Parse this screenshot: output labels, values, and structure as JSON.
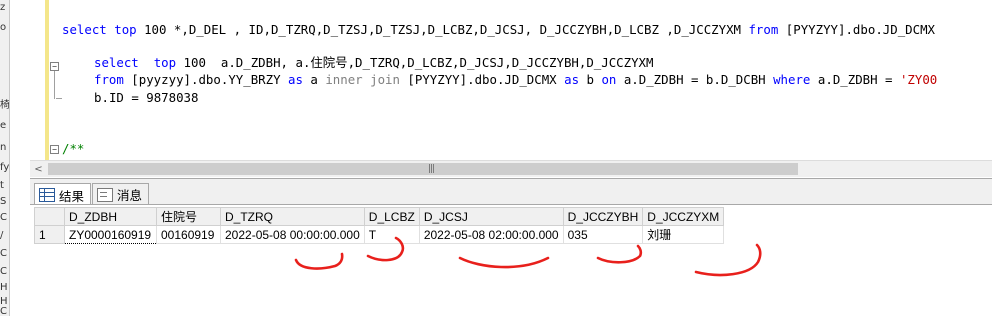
{
  "editor": {
    "query_line": "select top 100 *,D_DEL , ID,D_TZRQ,D_TZSJ,D_TZSJ,D_LCBZ,D_JCSJ, D_JCCZYBH,D_LCBZ ,D_JCCZYXM from [PYYZYY].dbo.JD_DCMX",
    "sub_line1": "select  top 100  a.D_ZDBH, a.住院号,D_TZRQ,D_LCBZ,D_JCSJ,D_JCCZYBH,D_JCCZYXM",
    "sub_line2": "from [pyyzyy].dbo.YY_BRZY as a inner join [PYYZYY].dbo.JD_DCMX as b on a.D_ZDBH = b.D_DCBH where a.D_ZDBH = 'ZY00",
    "sub_line3": "b.ID = 9878038",
    "comment_line": "/**",
    "collapse_symbol": "−"
  },
  "left_strip_chars": [
    "z",
    "o",
    "椅",
    "e",
    "n",
    "fy",
    "t",
    "S",
    "C",
    "/",
    "C",
    "C",
    "H",
    "H",
    "C"
  ],
  "scroll": {
    "left_arrow": "<",
    "grip": "|||"
  },
  "tabs": {
    "results_label": "结果",
    "messages_label": "消息"
  },
  "results": {
    "columns": [
      "D_ZDBH",
      "住院号",
      "D_TZRQ",
      "D_LCBZ",
      "D_JCSJ",
      "D_JCCZYBH",
      "D_JCCZYXM"
    ],
    "rows": [
      {
        "rownum": "1",
        "cells": [
          "ZY0000160919",
          "00160919",
          "2022-05-08 00:00:00.000",
          "T",
          "2022-05-08 02:00:00.000",
          "035",
          "刘珊"
        ]
      }
    ]
  },
  "colors": {
    "keyword": "#0000ff",
    "comment": "#008000",
    "string": "#c00000",
    "annotation": "#e8201c"
  }
}
